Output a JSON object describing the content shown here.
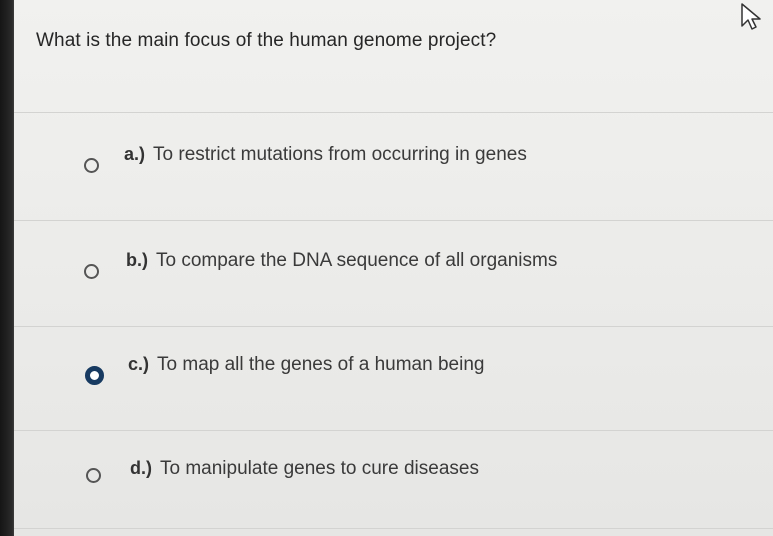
{
  "question": {
    "text": "What is the main focus of the human genome project?"
  },
  "options": [
    {
      "letter": "a.)",
      "text": "To restrict mutations from occurring in genes",
      "selected": false
    },
    {
      "letter": "b.)",
      "text": "To compare the DNA sequence of all organisms",
      "selected": false
    },
    {
      "letter": "c.)",
      "text": "To map all the genes of a human being",
      "selected": true
    },
    {
      "letter": "d.)",
      "text": "To manipulate genes to cure diseases",
      "selected": false
    }
  ],
  "colors": {
    "selected_radio": "#173a61",
    "page_background": "#eeeeec"
  },
  "icons": {
    "cursor": "mouse-pointer-icon"
  }
}
